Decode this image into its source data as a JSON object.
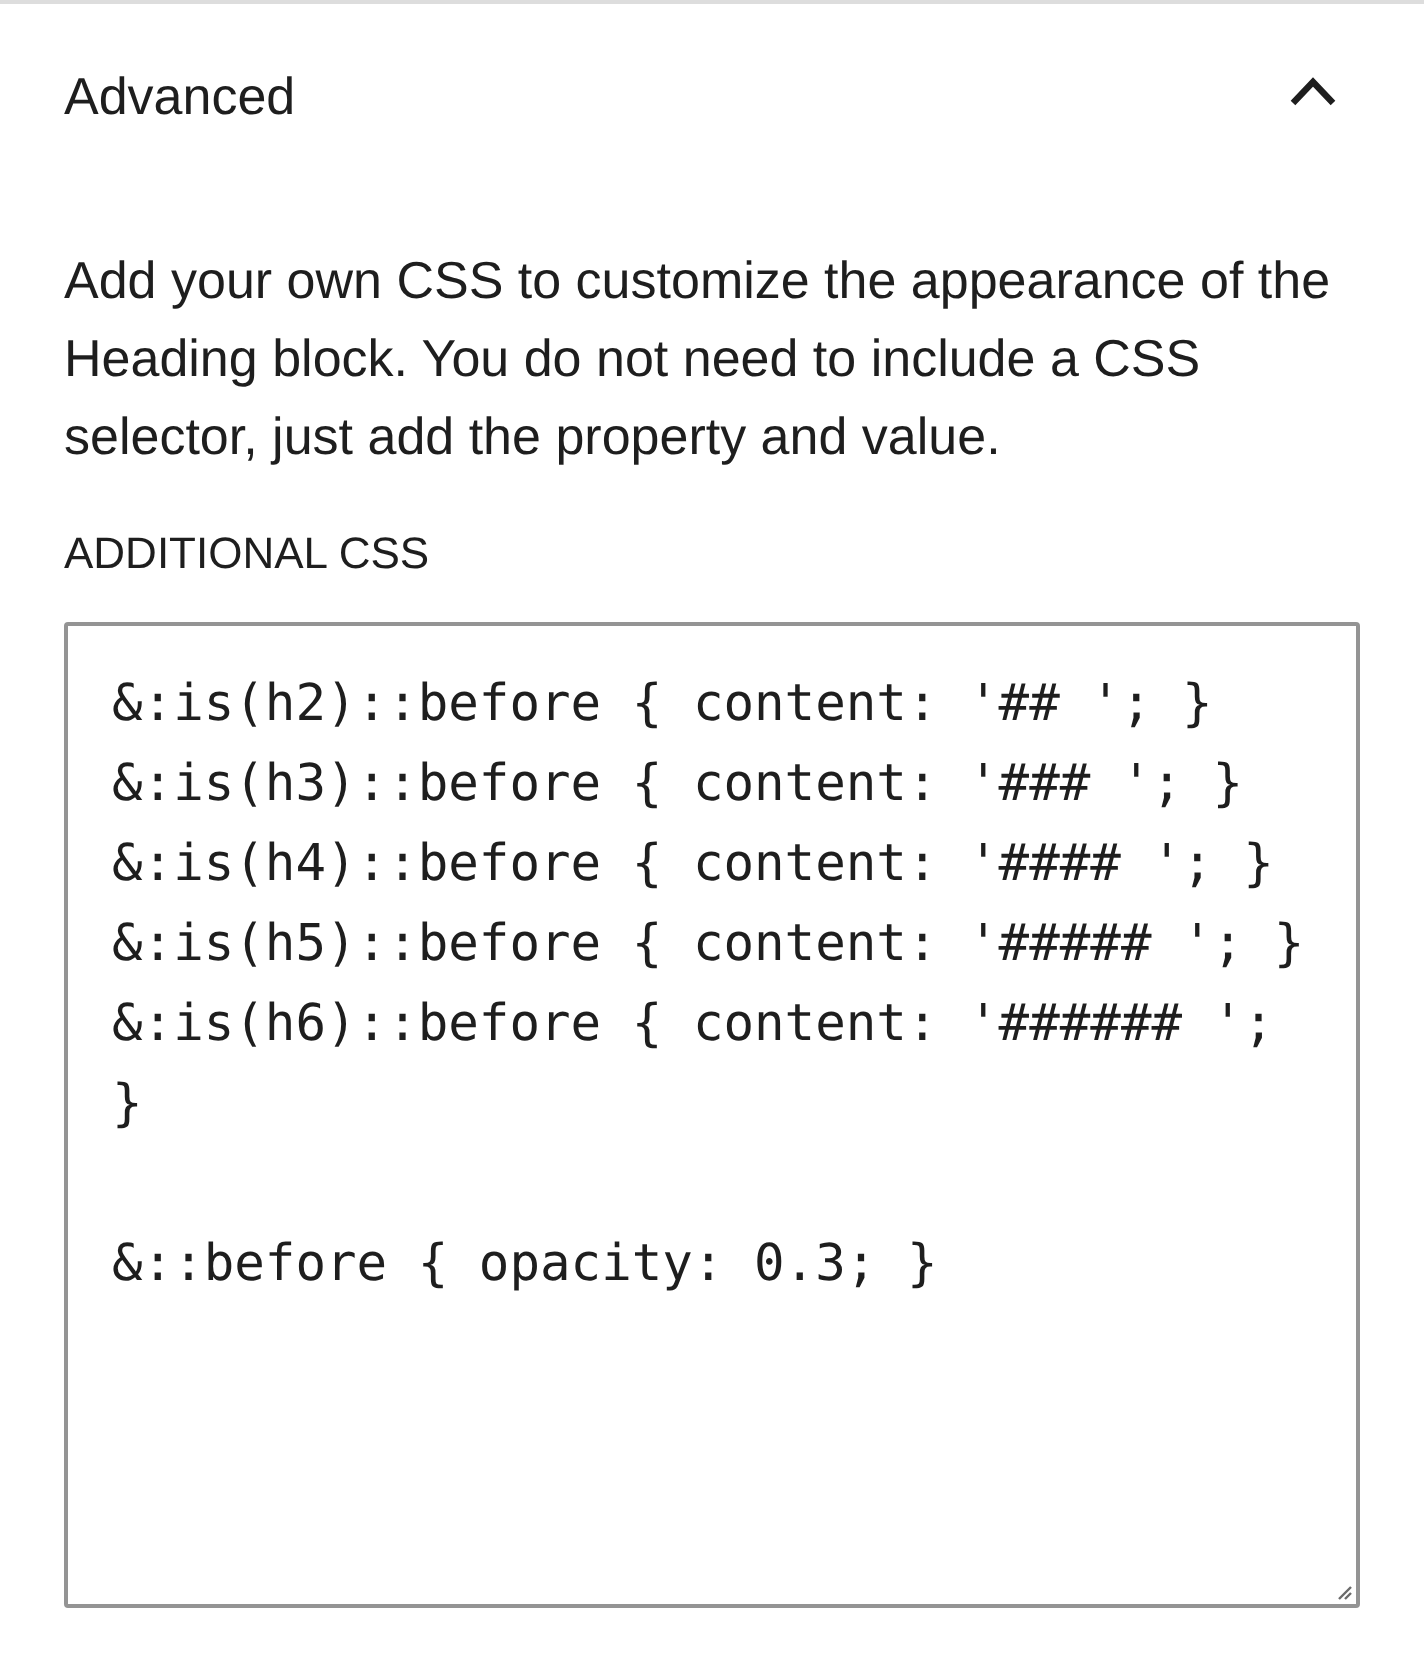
{
  "panel": {
    "title": "Advanced",
    "expanded": true
  },
  "description": "Add your own CSS to customize the appearance of the Heading block. You do not need to include a CSS selector, just add the property and value.",
  "additional_css": {
    "label": "ADDITIONAL CSS",
    "value": "&:is(h2)::before { content: '## '; }\n&:is(h3)::before { content: '### '; }\n&:is(h4)::before { content: '#### '; }\n&:is(h5)::before { content: '##### '; }\n&:is(h6)::before { content: '###### '; }\n\n&::before { opacity: 0.3; }"
  }
}
